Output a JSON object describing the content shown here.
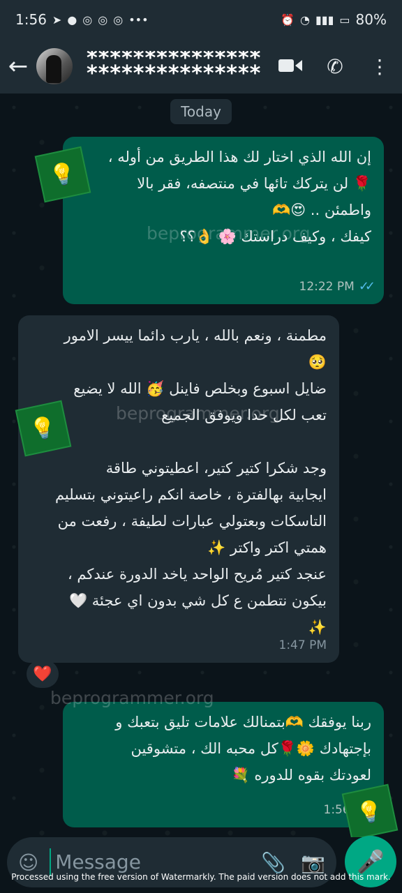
{
  "status_bar": {
    "time": "1:56",
    "left_icons": [
      "telegram-icon",
      "messenger-icon",
      "chrome-icon",
      "chrome-icon",
      "chrome-icon",
      "more-dots-icon"
    ],
    "battery": "80%"
  },
  "header": {
    "contact_name": "***************",
    "contact_name_line2": "***************"
  },
  "chat": {
    "day_label": "Today",
    "messages": [
      {
        "direction": "out",
        "text": "إن الله الذي اختار لك هذا الطريق من أوله ،\n🌹 لن يتركك تائها في منتصفه، فقر بالا\nواطمئن .. 😍🫶\nكيفك ، وكيف دراستك 🌸 👌؟؟",
        "time": "12:22 PM"
      },
      {
        "direction": "in",
        "text": "مطمنة ، ونعم بالله ، يارب دائما ييسر الامور\n🥺\nضايل اسبوع وبخلص فاينل 🥳 الله لا يضيع\nتعب لكل حدا ويوفق الجميع\n\nوجد شكرا كتير كتير،  اعطيتوني طاقة\nايجابية بهالفترة ، خاصة انكم راعيتوني بتسليم\nالتاسكات وبعتولي عبارات لطيفة ، رفعت من\nهمتي اكتر واكتر ✨\nعنجد كتير مُريح الواحد ياخد الدورة عندكم ،\nبيكون نتطمن ع كل شي بدون اي عجئة 🤍\n✨",
        "time": "1:47 PM"
      },
      {
        "direction": "out",
        "text": "ربنا يوفقك 🫶بتمنالك علامات تليق بتعبك و\nبإجتهادك 🌼🌹كل محبه الك ، متشوقين\nلعودتك بقوه للدوره 💐",
        "time": "1:56 PM"
      }
    ],
    "reaction": "❤️",
    "watermark": "beprogrammer.org"
  },
  "composer": {
    "placeholder": "Message"
  },
  "footer_note": "Processed using the free version of Watermarkly. The paid version does not add this mark."
}
